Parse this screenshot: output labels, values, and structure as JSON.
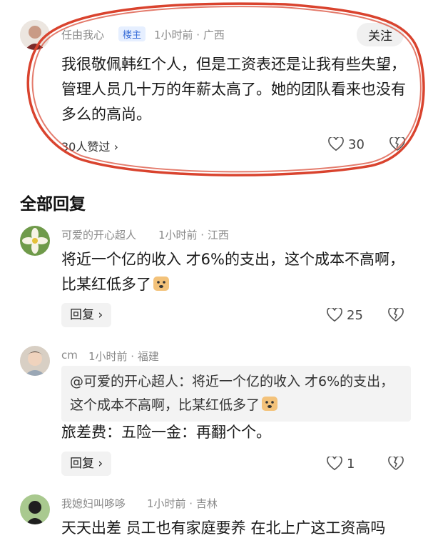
{
  "main_comment": {
    "author": "任由我心",
    "badge": "楼主",
    "meta": "1小时前 · 广西",
    "follow_label": "关注",
    "text": "我很敬佩韩红个人，但是工资表还是让我有些失望，管理人员几十万的年薪太高了。她的团队看来也没有多么的高尚。",
    "likes_link": "30人赞过 ›",
    "like_count": "30"
  },
  "section_title": "全部回复",
  "replies": [
    {
      "author": "可爱的开心超人",
      "meta": "1小时前 · 江西",
      "text": "将近一个亿的收入 才6%的支出，这个成本不高啊，比某红低多了",
      "reply_label": "回复 ›",
      "like_count": "25"
    },
    {
      "author": "cm",
      "meta": "1小时前 · 福建",
      "quote": "@可爱的开心超人：将近一个亿的收入 才6%的支出，这个成本不高啊，比某红低多了",
      "text": "旅差费：五险一金：再翻个个。",
      "reply_label": "回复 ›",
      "like_count": "1"
    },
    {
      "author": "我媳妇叫哆哆",
      "meta": "1小时前 · 吉林",
      "text": "天天出差 员工也有家庭要养 在北上广这工资高吗"
    }
  ],
  "colors": {
    "annotation": "#d9432e",
    "badge_bg": "#e6efff",
    "badge_text": "#3b6fd8"
  }
}
